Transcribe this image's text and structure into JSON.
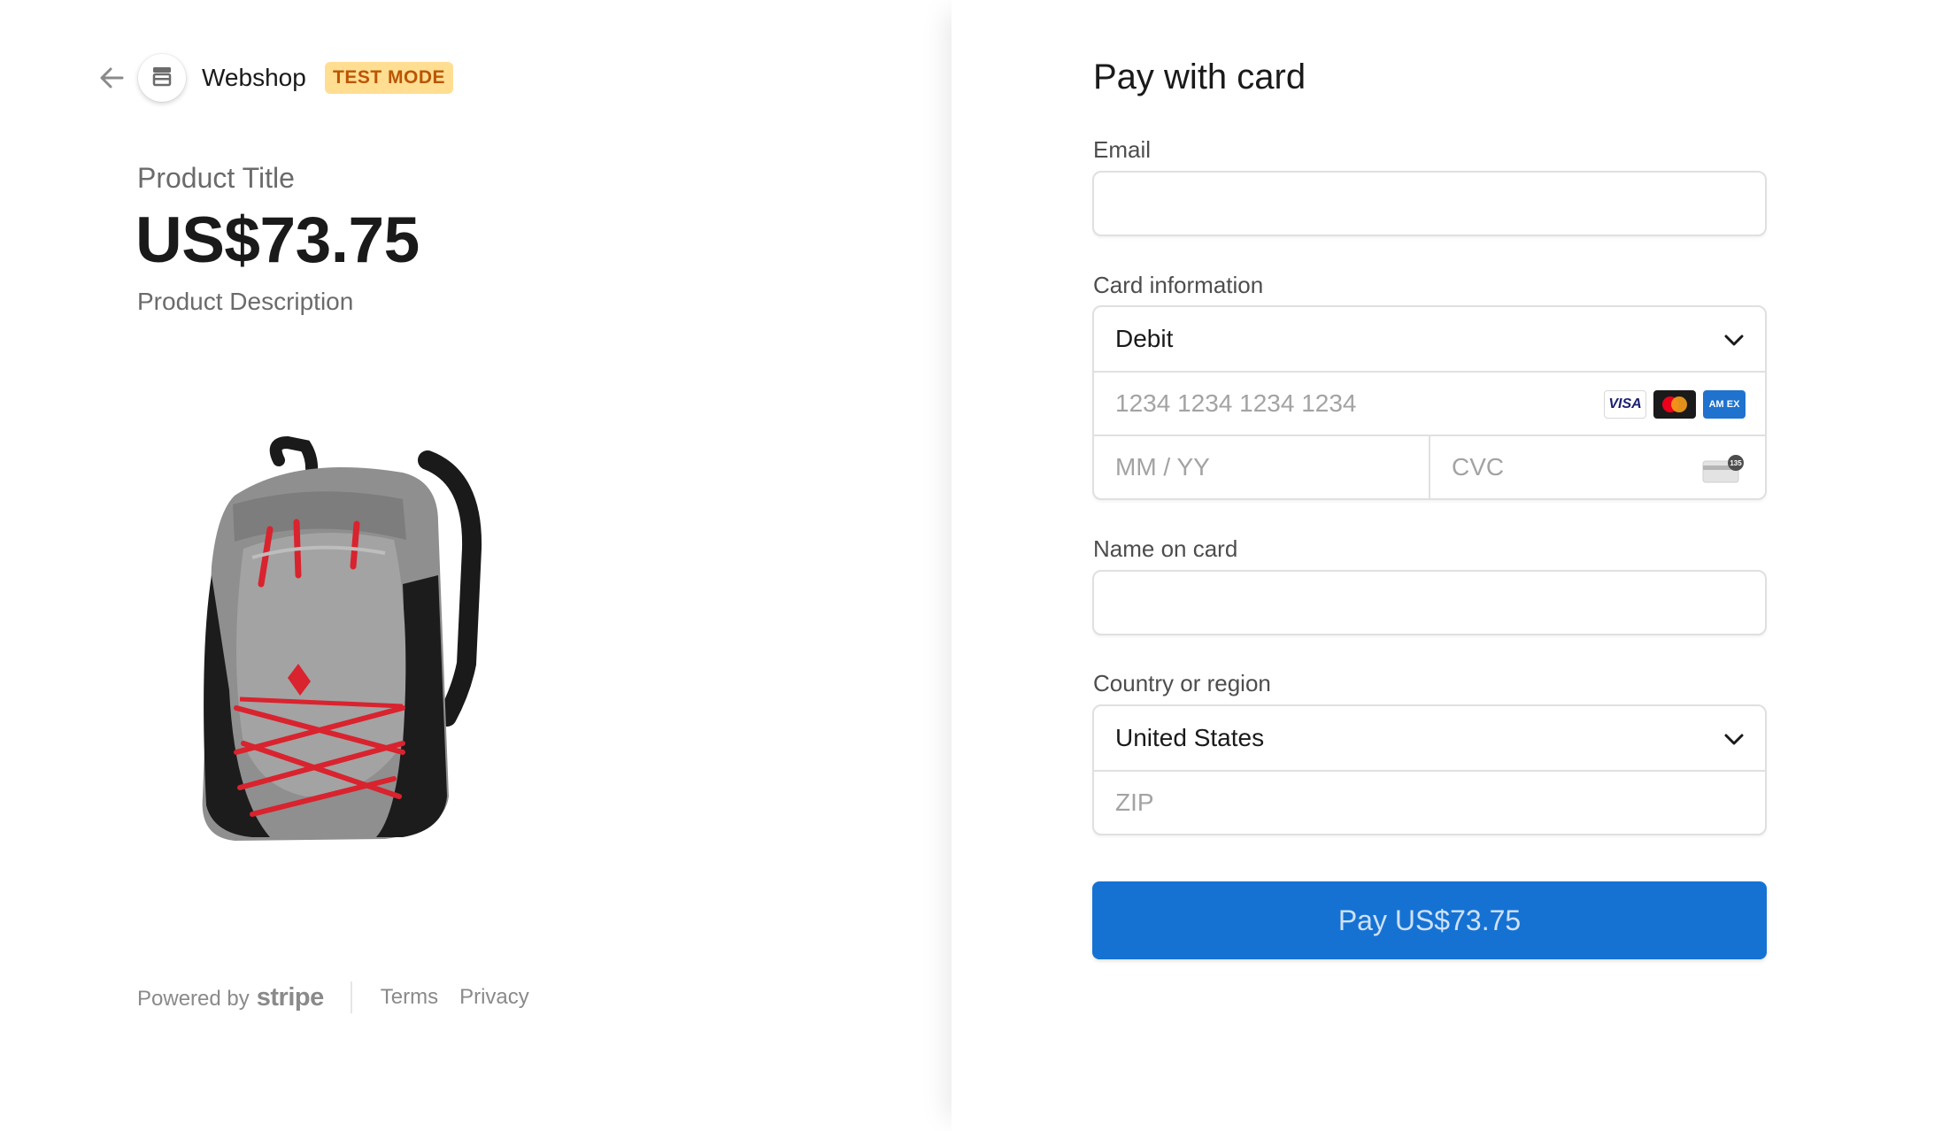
{
  "header": {
    "shop_name": "Webshop",
    "badge": "TEST MODE"
  },
  "product": {
    "title": "Product Title",
    "price": "US$73.75",
    "description": "Product Description"
  },
  "footer": {
    "powered_by": "Powered by",
    "brand": "stripe",
    "terms": "Terms",
    "privacy": "Privacy"
  },
  "form": {
    "title": "Pay with card",
    "email_label": "Email",
    "email_value": "",
    "card_label": "Card information",
    "card_type": "Debit",
    "card_number_placeholder": "1234 1234 1234 1234",
    "expiry_placeholder": "MM / YY",
    "cvc_placeholder": "CVC",
    "card_brands": {
      "visa": "VISA",
      "amex": "AM EX"
    },
    "cvc_icon_text": "135",
    "name_label": "Name on card",
    "name_value": "",
    "country_label": "Country or region",
    "country": "United States",
    "zip_placeholder": "ZIP",
    "pay_button": "Pay US$73.75"
  },
  "colors": {
    "accent": "#1572d3",
    "badge_bg": "#ffde92",
    "badge_text": "#bb5504"
  },
  "icons": [
    "back-arrow-icon",
    "store-icon",
    "chevron-down-icon",
    "visa-icon",
    "mastercard-icon",
    "amex-icon",
    "cvc-card-icon"
  ]
}
